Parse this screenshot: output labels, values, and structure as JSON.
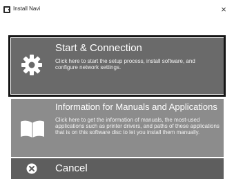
{
  "window": {
    "title": "Install Navi",
    "close_symbol": "×"
  },
  "options": {
    "start": {
      "title": "Start & Connection",
      "description": "Click here to start the setup process, install software, and configure network settings.",
      "icon": "gear-icon"
    },
    "info": {
      "title": "Information for Manuals and Applications",
      "description": "Click here to get the information of manuals, the most-used applications such as printer drivers, and paths of these applications that is on this software disc to let you install them manually.",
      "icon": "open-book-icon"
    },
    "cancel": {
      "title": "Cancel",
      "icon": "close-circle-icon"
    }
  },
  "colors": {
    "selected_border": "#151515",
    "start_bg": "#6a6a6a",
    "info_bg": "#8a8a8a",
    "cancel_bg": "#5e5e5e"
  }
}
